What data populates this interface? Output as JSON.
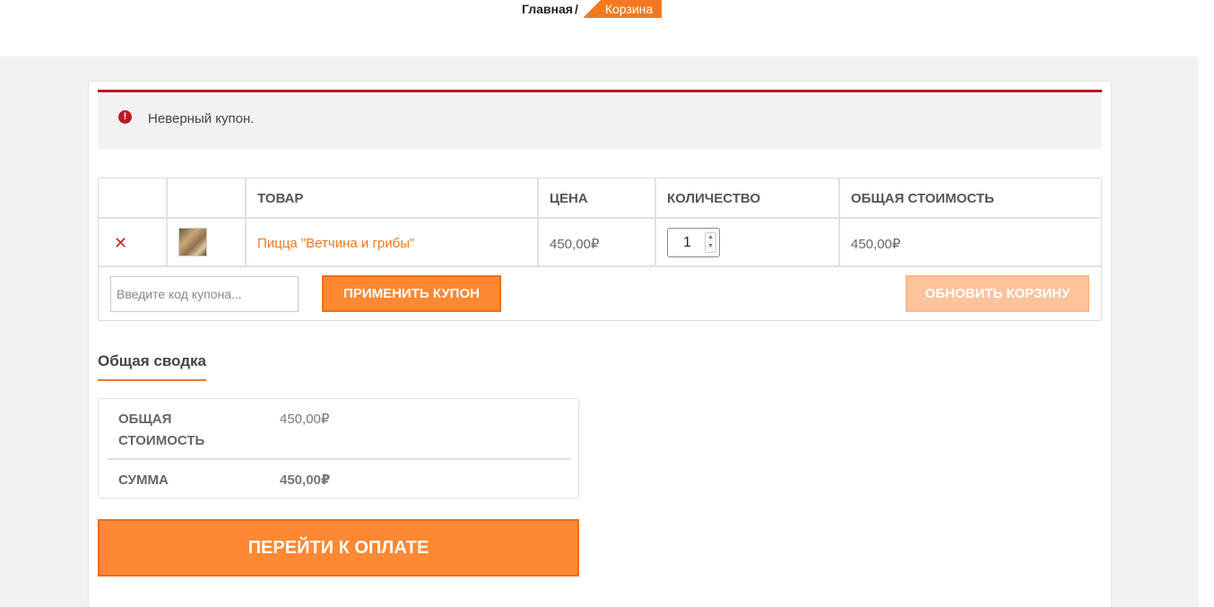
{
  "breadcrumb": {
    "home": "Главная",
    "separator": "/",
    "current": "Корзина"
  },
  "notice": {
    "icon": "exclamation-icon",
    "text": "Неверный купон."
  },
  "cart": {
    "headers": [
      "",
      "",
      "Товар",
      "Цена",
      "Количество",
      "Общая стоимость"
    ],
    "items": [
      {
        "name": "Пицца \"Ветчина и грибы\"",
        "price": "450,00₽",
        "quantity": "1",
        "subtotal": "450,00₽"
      }
    ],
    "coupon_placeholder": "Введите код купона...",
    "apply_coupon": "Применить купон",
    "update_cart": "Обновить корзину"
  },
  "totals": {
    "title": "Общая сводка",
    "subtotal_label_line1": "Общая",
    "subtotal_label_line2": "стоимость",
    "subtotal_value": "450,00₽",
    "total_label": "Сумма",
    "total_value": "450,00₽"
  },
  "checkout_label": "Перейти к оплате",
  "colors": {
    "accent": "#f37920",
    "button": "#ff8833",
    "button_disabled": "#ffc39c",
    "error": "#b81c23"
  }
}
